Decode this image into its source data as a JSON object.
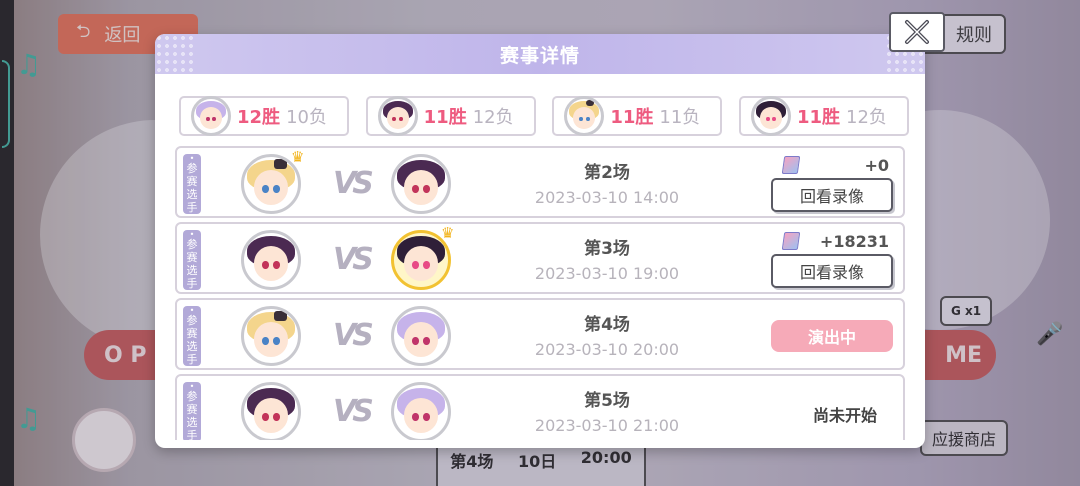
{
  "background": {
    "back_label": "返回",
    "rule_label": "规则",
    "shop_label": "应援商店",
    "left_banner": "O P",
    "right_banner": "ME",
    "table_cells": [
      "第4场",
      "10日",
      "20:00"
    ],
    "badge_text": "G x1"
  },
  "modal": {
    "title": "赛事详情",
    "close_icon": "close-x-icon"
  },
  "standings": [
    {
      "avatar": "lilac",
      "wins": "12胜",
      "losses": "10负"
    },
    {
      "avatar": "dark",
      "wins": "11胜",
      "losses": "12负"
    },
    {
      "avatar": "blonde",
      "wins": "11胜",
      "losses": "11负"
    },
    {
      "avatar": "pink",
      "wins": "11胜",
      "losses": "12负"
    }
  ],
  "tag_text": [
    "参",
    "赛",
    "选",
    "手"
  ],
  "matches": [
    {
      "title": "第2场",
      "date": "2023-03-10 14:00",
      "p1": "blonde",
      "p2": "dark",
      "winner": "p1",
      "score": "+0",
      "action": "回看录像",
      "state": "replay"
    },
    {
      "title": "第3场",
      "date": "2023-03-10 19:00",
      "p1": "dark",
      "p2": "pink",
      "winner": "p2",
      "score": "+18231",
      "action": "回看录像",
      "state": "replay"
    },
    {
      "title": "第4场",
      "date": "2023-03-10 20:00",
      "p1": "blonde",
      "p2": "lilac",
      "winner": "",
      "score": "",
      "action": "演出中",
      "state": "live"
    },
    {
      "title": "第5场",
      "date": "2023-03-10 21:00",
      "p1": "dark",
      "p2": "lilac",
      "winner": "",
      "score": "",
      "action": "尚未开始",
      "state": "pending"
    }
  ],
  "vs_text": "VS",
  "colors": {
    "accent": "#bfb5ea",
    "win": "#ee5b80",
    "live": "#f6aab8"
  }
}
